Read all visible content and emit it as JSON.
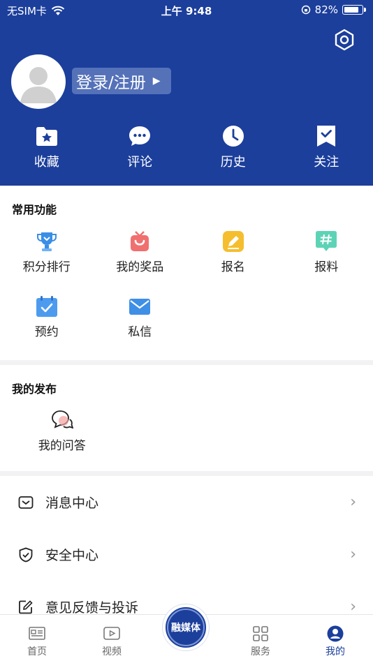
{
  "status_bar": {
    "carrier": "无SIM卡",
    "time": "上午 9:48",
    "battery": "82%",
    "battery_level": 0.82
  },
  "header": {
    "login_label": "登录/注册",
    "quick_actions": [
      {
        "label": "收藏",
        "icon": "folder-star-icon"
      },
      {
        "label": "评论",
        "icon": "comment-icon"
      },
      {
        "label": "历史",
        "icon": "clock-icon"
      },
      {
        "label": "关注",
        "icon": "bookmark-check-icon"
      }
    ]
  },
  "common": {
    "title": "常用功能",
    "items": [
      {
        "label": "积分排行",
        "icon": "trophy-icon"
      },
      {
        "label": "我的奖品",
        "icon": "gift-icon"
      },
      {
        "label": "报名",
        "icon": "edit-icon"
      },
      {
        "label": "报料",
        "icon": "hashtag-icon"
      },
      {
        "label": "预约",
        "icon": "calendar-check-icon"
      },
      {
        "label": "私信",
        "icon": "mail-icon"
      }
    ]
  },
  "publish": {
    "title": "我的发布",
    "items": [
      {
        "label": "我的问答",
        "icon": "chat-bubbles-icon"
      }
    ]
  },
  "menu": [
    {
      "label": "消息中心",
      "icon": "message-icon"
    },
    {
      "label": "安全中心",
      "icon": "shield-check-icon"
    },
    {
      "label": "意见反馈与投诉",
      "icon": "feedback-edit-icon"
    }
  ],
  "tabbar": {
    "tabs": [
      {
        "label": "首页",
        "icon": "news-icon"
      },
      {
        "label": "视频",
        "icon": "video-icon"
      },
      {
        "label": "服务",
        "icon": "grid-icon"
      },
      {
        "label": "我的",
        "icon": "user-icon"
      }
    ],
    "center_label": "融媒体",
    "active_tab": "我的"
  },
  "colors": {
    "brand": "#1c3f9c",
    "accent_light": "#5572b9"
  }
}
